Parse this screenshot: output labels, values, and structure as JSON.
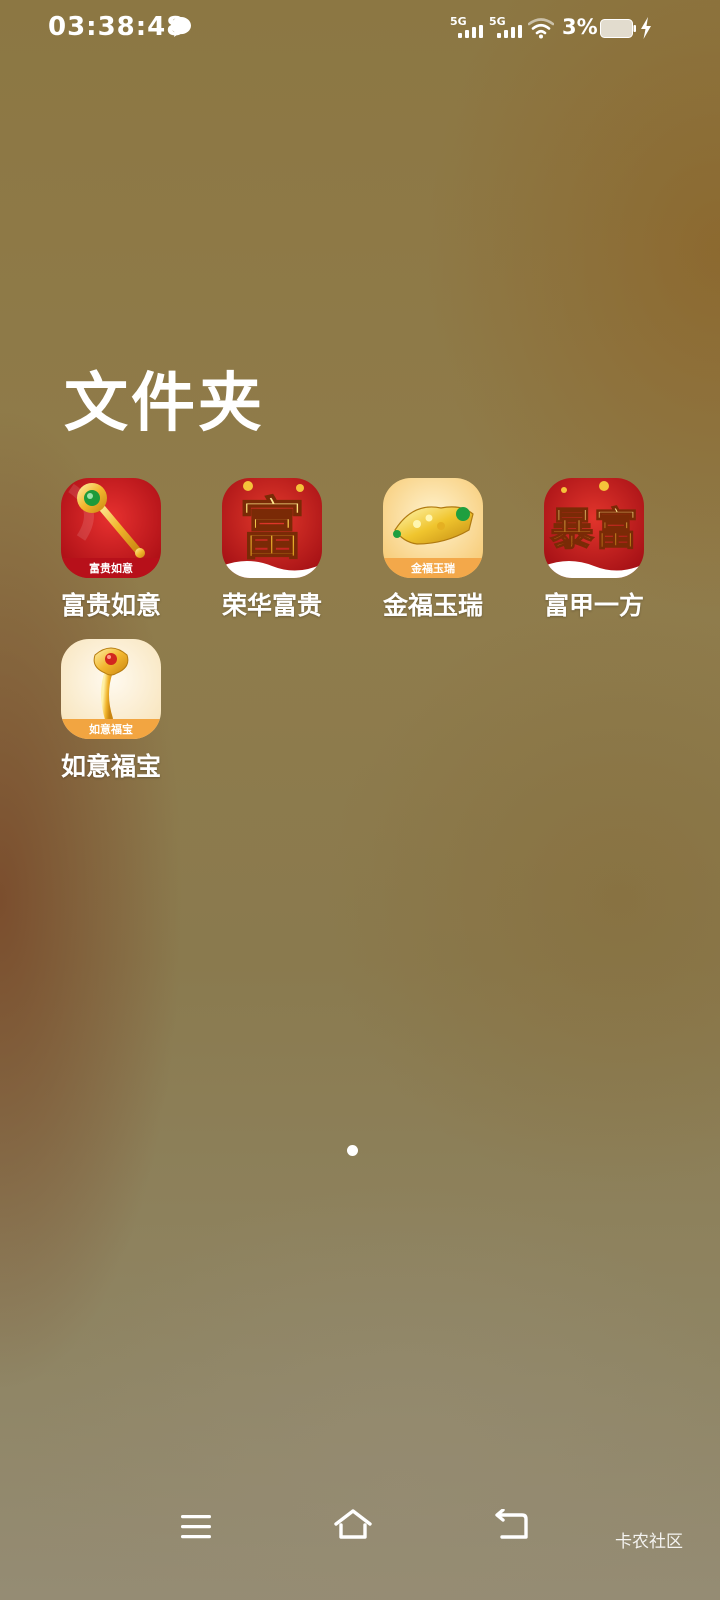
{
  "status_bar": {
    "time": "03:38:48",
    "notification_icon": "chat-bubble-icon",
    "signal_1_label": "5G",
    "signal_2_label": "5G",
    "wifi_icon": "wifi-icon",
    "battery_percent": "3%",
    "battery_level": 0.03,
    "charging": true
  },
  "folder": {
    "title": "文件夹",
    "apps": [
      {
        "label": "富贵如意",
        "icon_text": "富贵如意",
        "icon": "golden-ruyi-red-icon"
      },
      {
        "label": "荣华富贵",
        "icon_text": "富",
        "icon": "fu-character-red-icon"
      },
      {
        "label": "金福玉瑞",
        "icon_text": "金福玉瑞",
        "icon": "gold-ingot-jade-icon"
      },
      {
        "label": "富甲一方",
        "icon_text": "暴富",
        "icon": "baofu-characters-red-icon"
      },
      {
        "label": "如意福宝",
        "icon_text": "如意福宝",
        "icon": "golden-ruyi-cream-icon"
      }
    ]
  },
  "page_indicator": {
    "current": 1,
    "total": 1
  },
  "nav_bar": {
    "menu_icon": "menu-icon",
    "home_icon": "home-icon",
    "back_icon": "back-icon"
  },
  "watermark": "卡农社区",
  "colors": {
    "icon_red": "#c8161d",
    "icon_gold": "#f2b62e",
    "icon_cream": "#fbe9c4"
  }
}
